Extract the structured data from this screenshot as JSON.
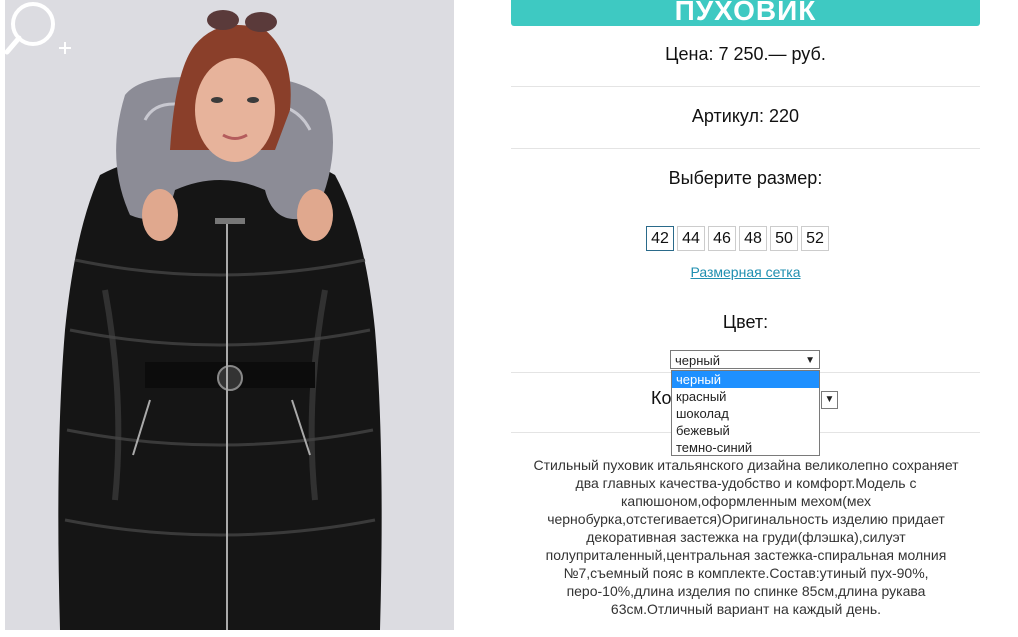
{
  "product": {
    "title": "ПУХОВИК",
    "price": "Цена: 7 250.— руб.",
    "article": "Артикул: 220",
    "size_label": "Выберите размер:",
    "sizes": [
      "42",
      "44",
      "46",
      "48",
      "50",
      "52"
    ],
    "selected_size": "42",
    "size_chart_link": "Размерная сетка",
    "color_label": "Цвет:",
    "color_value": "черный",
    "color_options": [
      "черный",
      "красный",
      "шоколад",
      "бежевый",
      "темно-синий"
    ],
    "quantity_label_partial": "Ко",
    "description": "Стильный пуховик итальянского дизайна великолепно сохраняет два главных качества-удобство и комфорт.Модель с капюшоном,оформленным мехом(мех чернобурка,отстегивается)Оригинальность изделию придает декоративная застежка на груди(флэшка),силуэт полуприталенный,центральная застежка-спиральная молния №7,съемный пояс в комплекте.Состав:утиный пух-90%, перо-10%,длина изделия по спинке 85см,длина рукава 63см.Отличный вариант на каждый день."
  },
  "colors": {
    "accent": "#3ec9c2",
    "link": "#1f8fb0",
    "highlight": "#1e90ff"
  },
  "icons": {
    "zoom": "magnifier-plus-icon"
  }
}
